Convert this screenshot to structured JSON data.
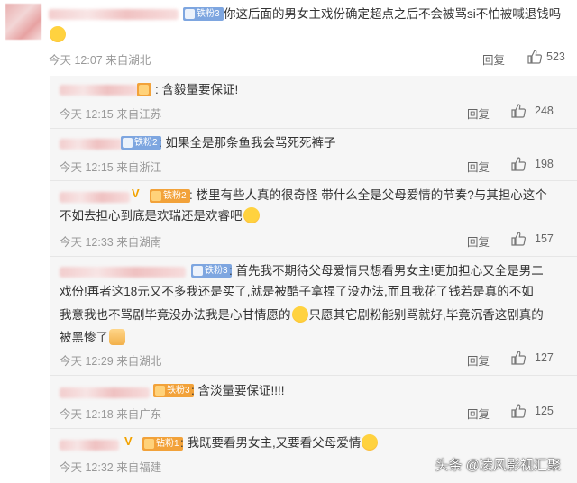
{
  "top": {
    "badge": "铁粉3",
    "text": "你这后面的男女主戏份确定超点之后不会被骂si不怕被喊退钱吗",
    "time": "今天 12:07",
    "location": "来自湖北",
    "reply": "回复",
    "likes": "523"
  },
  "replies": [
    {
      "badge": "",
      "text": "含毅量要保证!",
      "time": "今天 12:15",
      "location": "来自江苏",
      "reply": "回复",
      "likes": "248"
    },
    {
      "badge": "铁粉2",
      "text": "如果全是那条鱼我会骂死死裤子",
      "time": "今天 12:15",
      "location": "来自浙江",
      "reply": "回复",
      "likes": "198"
    },
    {
      "badge": "铁粉2",
      "text_l1": "楼里有些人真的很奇怪 带什么全是父母爱情的节奏?与其担心这个",
      "text_l2": "不如去担心到底是欢瑞还是欢睿吧",
      "time": "今天 12:33",
      "location": "来自湖南",
      "reply": "回复",
      "likes": "157"
    },
    {
      "badge": "铁粉3",
      "text_l1": "首先我不期待父母爱情只想看男女主!更加担心又全是男二",
      "text_l2": "戏份!再者这18元又不多我还是买了,就是被酷子拿捏了没办法,而且我花了钱若是真的不如",
      "text_l3a": "我意我也不骂剧毕竟没办法我是心甘情愿的",
      "text_l3b": "只愿其它剧粉能别骂就好,毕竟沉香这剧真的",
      "text_l4": "被黑惨了",
      "time": "今天 12:29",
      "location": "来自湖北",
      "reply": "回复",
      "likes": "127"
    },
    {
      "badge": "铁粉3",
      "text": "含淡量要保证!!!!",
      "time": "今天 12:18",
      "location": "来自广东",
      "reply": "回复",
      "likes": "125"
    },
    {
      "badge": "钻粉1",
      "text": "我既要看男女主,又要看父母爱情",
      "time": "今天 12:32",
      "location": "来自福建",
      "reply": "回复",
      "likes": ""
    }
  ],
  "watermark": "头条 @凌风影视汇聚",
  "icons": {
    "thumb": "thumbs-up-icon",
    "laugh": "laughing-emoji-icon"
  },
  "colors": {
    "badge_blue": "#7ea6e0",
    "badge_orange": "#f2a23a"
  }
}
